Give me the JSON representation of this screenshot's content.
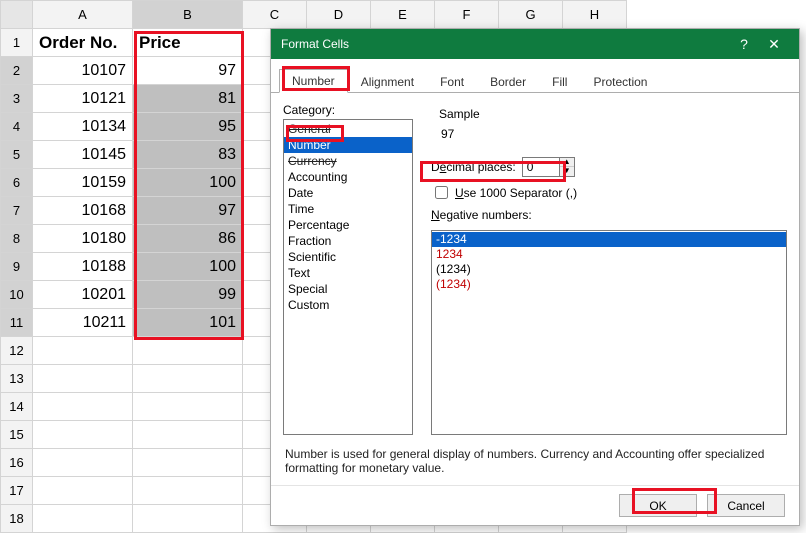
{
  "columns": [
    "A",
    "B",
    "C",
    "D",
    "E",
    "F",
    "G",
    "H"
  ],
  "rows_count": 18,
  "header": {
    "a": "Order No.",
    "b": "Price"
  },
  "data": [
    {
      "order": "10107",
      "price": "97"
    },
    {
      "order": "10121",
      "price": "81"
    },
    {
      "order": "10134",
      "price": "95"
    },
    {
      "order": "10145",
      "price": "83"
    },
    {
      "order": "10159",
      "price": "100"
    },
    {
      "order": "10168",
      "price": "97"
    },
    {
      "order": "10180",
      "price": "86"
    },
    {
      "order": "10188",
      "price": "100"
    },
    {
      "order": "10201",
      "price": "99"
    },
    {
      "order": "10211",
      "price": "101"
    }
  ],
  "dialog": {
    "title": "Format Cells",
    "help": "?",
    "close": "✕",
    "tabs": [
      "Number",
      "Alignment",
      "Font",
      "Border",
      "Fill",
      "Protection"
    ],
    "active_tab": 0,
    "category_label": "Category:",
    "categories": [
      "General",
      "Number",
      "Currency",
      "Accounting",
      "Date",
      "Time",
      "Percentage",
      "Fraction",
      "Scientific",
      "Text",
      "Special",
      "Custom"
    ],
    "selected_category": 1,
    "sample_label": "Sample",
    "sample_value": "97",
    "decimal_label_pre": "D",
    "decimal_label_u": "e",
    "decimal_label_post": "cimal places:",
    "decimal_value": "0",
    "separator_pre": "",
    "separator_u": "U",
    "separator_post": "se 1000 Separator (,)",
    "neg_label": "Negative numbers:",
    "neg_u": "N",
    "neg_rest": "egative numbers:",
    "neg_items": [
      {
        "text": "-1234",
        "red": false
      },
      {
        "text": "1234",
        "red": true
      },
      {
        "text": "(1234)",
        "red": false
      },
      {
        "text": "(1234)",
        "red": true
      }
    ],
    "neg_selected": 0,
    "description": "Number is used for general display of numbers.  Currency and Accounting offer specialized formatting for monetary value.",
    "ok": "OK",
    "cancel": "Cancel"
  }
}
